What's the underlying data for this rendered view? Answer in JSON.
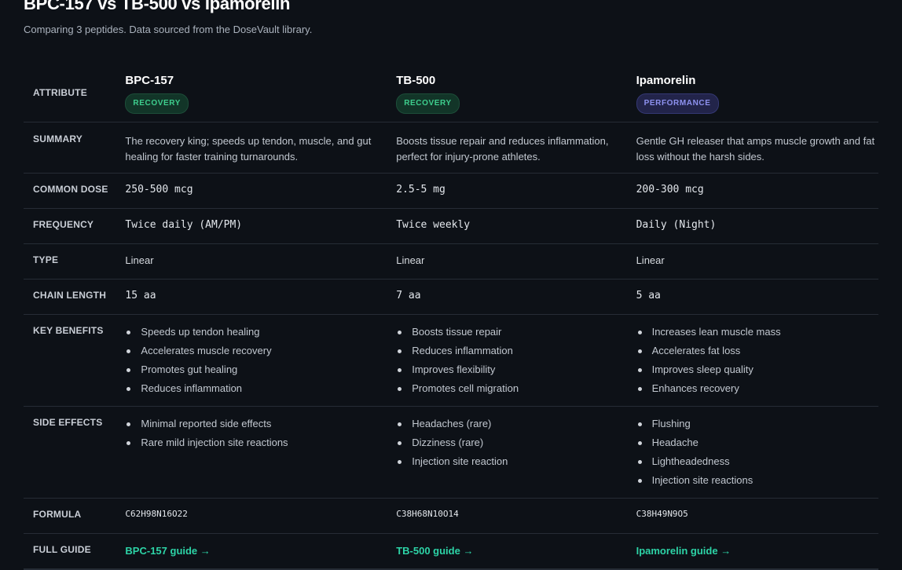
{
  "page": {
    "title": "BPC-157 vs TB-500 vs Ipamorelin",
    "subtitle": "Comparing 3 peptides. Data sourced from the DoseVault library."
  },
  "table": {
    "attribute_header": "ATTRIBUTE",
    "peptides": [
      {
        "name": "BPC-157",
        "badge": "RECOVERY",
        "badge_color": "#3ecf8e",
        "summary": "The recovery king; speeds up tendon, muscle, and gut healing for faster training turnarounds.",
        "common_dose": "250-500 mcg",
        "frequency": "Twice daily (AM/PM)",
        "type": "Linear",
        "chain_length": "15 aa",
        "key_benefits": [
          "Speeds up tendon healing",
          "Accelerates muscle recovery",
          "Promotes gut healing",
          "Reduces inflammation"
        ],
        "side_effects": [
          "Minimal reported side effects",
          "Rare mild injection site reactions"
        ],
        "formula": "C62H98N16O22",
        "guide_link": "BPC-157 guide →"
      },
      {
        "name": "TB-500",
        "badge": "RECOVERY",
        "badge_color": "#3ecf8e",
        "summary": "Boosts tissue repair and reduces inflammation, perfect for injury-prone athletes.",
        "common_dose": "2.5-5 mg",
        "frequency": "Twice weekly",
        "type": "Linear",
        "chain_length": "7 aa",
        "key_benefits": [
          "Boosts tissue repair",
          "Reduces inflammation",
          "Improves flexibility",
          "Promotes cell migration"
        ],
        "side_effects": [
          "Headaches (rare)",
          "Dizziness (rare)",
          "Injection site reaction"
        ],
        "formula": "C38H68N10O14",
        "guide_link": "TB-500 guide →"
      },
      {
        "name": "Ipamorelin",
        "badge": "PERFORMANCE",
        "badge_color": "#8e92f0",
        "summary": "Gentle GH releaser that amps muscle growth and fat loss without the harsh sides.",
        "common_dose": "200-300 mcg",
        "frequency": "Daily (Night)",
        "type": "Linear",
        "chain_length": "5 aa",
        "key_benefits": [
          "Increases lean muscle mass",
          "Accelerates fat loss",
          "Improves sleep quality",
          "Enhances recovery"
        ],
        "side_effects": [
          "Flushing",
          "Headache",
          "Lightheadedness",
          "Injection site reactions"
        ],
        "formula": "C38H49N9O5",
        "guide_link": "Ipamorelin guide →"
      }
    ],
    "row_labels": {
      "summary": "SUMMARY",
      "common_dose": "COMMON DOSE",
      "frequency": "FREQUENCY",
      "type": "TYPE",
      "chain_length": "CHAIN LENGTH",
      "key_benefits": "KEY BENEFITS",
      "side_effects": "SIDE EFFECTS",
      "formula": "FORMULA",
      "full_guide": "FULL GUIDE"
    }
  }
}
